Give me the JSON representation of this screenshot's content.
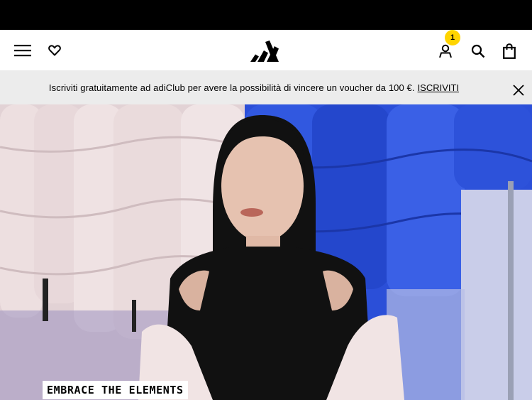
{
  "header": {
    "icons": {
      "menu": "hamburger-menu-icon",
      "wishlist": "heart-icon",
      "logo": "adidas-logo",
      "account": "user-icon",
      "search": "search-icon",
      "bag": "shopping-bag-icon"
    },
    "account_badge": "1",
    "badge_color": "#ffd400"
  },
  "promo": {
    "text": "Iscriviti gratuitamente ad adiClub per avere la possibilità di vincere un voucher da 100 €.",
    "link": "ISCRIVITI",
    "background": "#ececec"
  },
  "hero": {
    "tag": "EMBRACE THE ELEMENTS"
  },
  "colors": {
    "top_bar": "#000000",
    "blue_jackets": "#2c4fd6",
    "pink_jackets": "#e6d6d8"
  }
}
